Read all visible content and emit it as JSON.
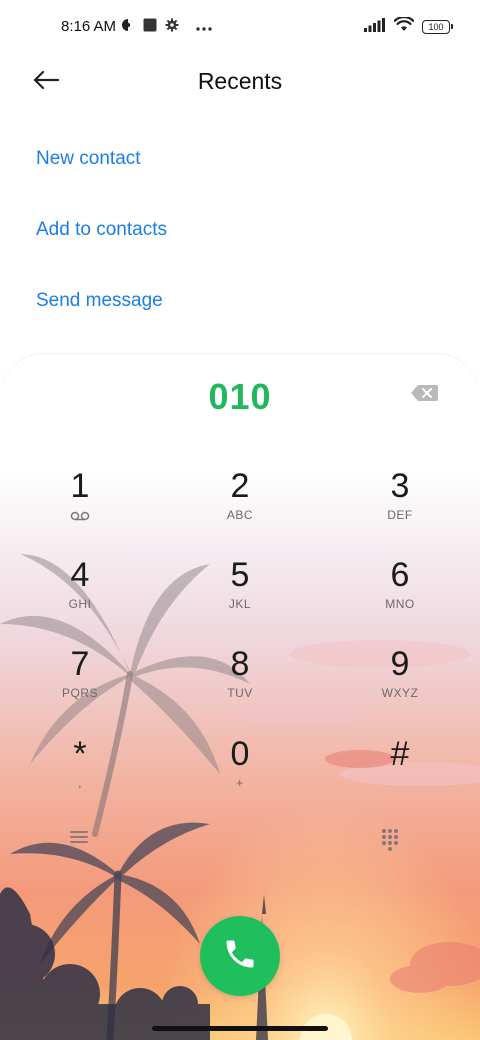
{
  "status_bar": {
    "time": "8:16 AM",
    "battery": "100",
    "icons": [
      "vpn-icon",
      "square-notification-icon",
      "settings-gear-icon",
      "more-dots-icon",
      "signal-icon",
      "wifi-icon",
      "battery-icon"
    ]
  },
  "header": {
    "title": "Recents",
    "back_icon": "back-arrow-icon"
  },
  "actions": [
    {
      "label": "New contact"
    },
    {
      "label": "Add to contacts"
    },
    {
      "label": "Send message"
    }
  ],
  "dialer": {
    "number": "010",
    "backspace_icon": "backspace-icon",
    "keys": [
      {
        "digit": "1",
        "letters": "",
        "sub_icon": "voicemail-icon"
      },
      {
        "digit": "2",
        "letters": "ABC"
      },
      {
        "digit": "3",
        "letters": "DEF"
      },
      {
        "digit": "4",
        "letters": "GHI"
      },
      {
        "digit": "5",
        "letters": "JKL"
      },
      {
        "digit": "6",
        "letters": "MNO"
      },
      {
        "digit": "7",
        "letters": "PQRS"
      },
      {
        "digit": "8",
        "letters": "TUV"
      },
      {
        "digit": "9",
        "letters": "WXYZ"
      },
      {
        "digit": "*",
        "letters": ","
      },
      {
        "digit": "0",
        "letters": "+"
      },
      {
        "digit": "#",
        "letters": ""
      }
    ],
    "menu_icon": "menu-icon",
    "dialpad_icon": "dialpad-icon",
    "call_icon": "phone-icon",
    "call_color": "#1fbf5d",
    "number_color": "#20b85a"
  },
  "colors": {
    "accent": "#1a7ee6"
  }
}
